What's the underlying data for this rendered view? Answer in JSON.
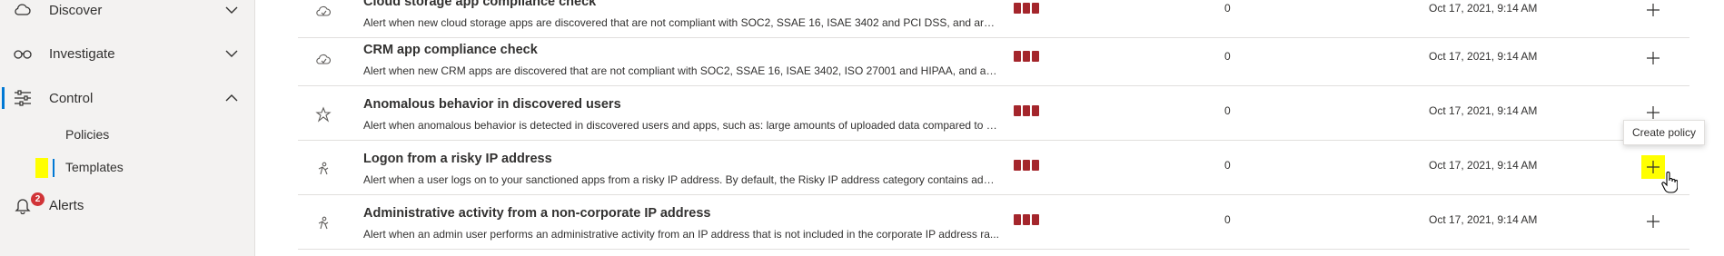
{
  "sidebar": {
    "items": [
      {
        "label": "Discover",
        "icon": "cloud-search-icon",
        "expanded": false
      },
      {
        "label": "Investigate",
        "icon": "glasses-icon",
        "expanded": false
      },
      {
        "label": "Control",
        "icon": "sliders-icon",
        "expanded": true
      },
      {
        "label": "Alerts",
        "icon": "bell-icon",
        "badge": "2"
      }
    ],
    "sub_items": [
      {
        "label": "Policies"
      },
      {
        "label": "Templates",
        "selected": true
      }
    ]
  },
  "rows": [
    {
      "title": "Cloud storage app compliance check",
      "description": "Alert when new cloud storage apps are discovered that are not compliant with SOC2, SSAE 16, ISAE 3402 and PCI DSS, and are us...",
      "count": "0",
      "date": "Oct 17, 2021, 9:14 AM",
      "icon": "cloud-check-icon"
    },
    {
      "title": "CRM app compliance check",
      "description": "Alert when new CRM apps are discovered that are not compliant with SOC2, SSAE 16, ISAE 3402, ISO 27001 and HIPAA, and are us...",
      "count": "0",
      "date": "Oct 17, 2021, 9:14 AM",
      "icon": "cloud-check-icon"
    },
    {
      "title": "Anomalous behavior in discovered users",
      "description": "Alert when anomalous behavior is detected in discovered users and apps, such as: large amounts of uploaded data compared to o...",
      "count": "0",
      "date": "Oct 17, 2021, 9:14 AM",
      "icon": "anomaly-icon"
    },
    {
      "title": "Logon from a risky IP address",
      "description": "Alert when a user logs on to your sanctioned apps from a risky IP address. By default, the Risky IP address category contains addr...",
      "count": "0",
      "date": "Oct 17, 2021, 9:14 AM",
      "icon": "activity-icon",
      "highlighted_add": true
    },
    {
      "title": "Administrative activity from a non-corporate IP address",
      "description": "Alert when an admin user performs an administrative activity from an IP address that is not included in the corporate IP address ra...",
      "count": "0",
      "date": "Oct 17, 2021, 9:14 AM",
      "icon": "activity-icon"
    }
  ],
  "tooltip": {
    "text": "Create policy"
  },
  "colors": {
    "severity_high": "#a4262c",
    "accent": "#0078d4",
    "highlight": "#ffff00",
    "badge": "#d13438"
  }
}
